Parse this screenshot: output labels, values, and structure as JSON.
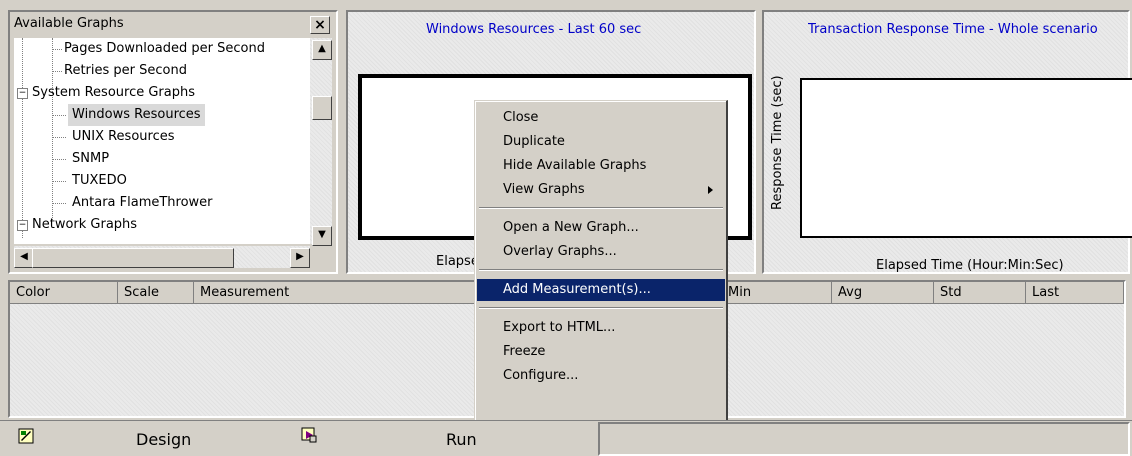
{
  "tree": {
    "title": "Available Graphs",
    "close_label": "×",
    "items": [
      {
        "label": "Pages Downloaded per Second"
      },
      {
        "label": "Retries per Second"
      },
      {
        "label": "System Resource Graphs"
      },
      {
        "label": "Windows Resources"
      },
      {
        "label": "UNIX Resources"
      },
      {
        "label": "SNMP"
      },
      {
        "label": "TUXEDO"
      },
      {
        "label": "Antara FlameThrower"
      },
      {
        "label": "Network Graphs"
      }
    ],
    "expander_minus": "−"
  },
  "graphs": [
    {
      "title": "Windows Resources - Last 60 sec",
      "xlabel": "Elapsed Time (Hour:Min:Sec)"
    },
    {
      "title": "Transaction Response Time - Whole scenario",
      "xlabel": "Elapsed Time (Hour:Min:Sec)",
      "ylabel": "Response Time (sec)"
    }
  ],
  "table": {
    "columns": [
      "Color",
      "Scale",
      "Measurement",
      "Min",
      "Avg",
      "Std",
      "Last"
    ]
  },
  "context_menu": {
    "items": [
      {
        "label": "Close"
      },
      {
        "label": "Duplicate"
      },
      {
        "label": "Hide Available Graphs"
      },
      {
        "label": "View Graphs"
      },
      {
        "label": "Open a New Graph..."
      },
      {
        "label": "Overlay Graphs..."
      },
      {
        "label": "Add Measurement(s)...",
        "highlighted": true
      },
      {
        "label": "Export to HTML..."
      },
      {
        "label": "Freeze"
      },
      {
        "label": "Configure..."
      }
    ]
  },
  "bottom_tabs": {
    "design_label": "Design",
    "run_label": "Run"
  },
  "colors": {
    "title_blue": "#0000c8",
    "menu_highlight": "#0a246a",
    "face": "#d4d0c8"
  }
}
